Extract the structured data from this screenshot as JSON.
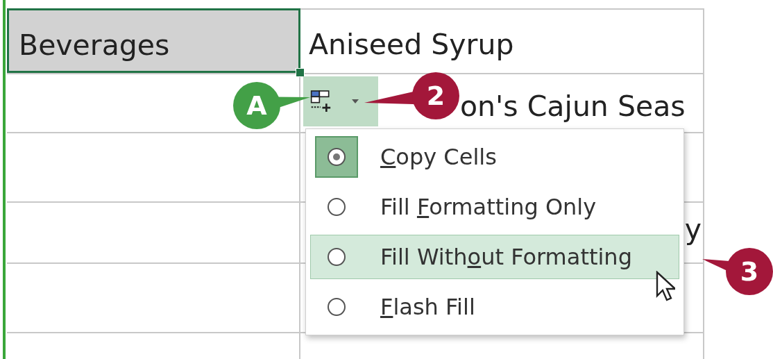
{
  "cells": [
    {
      "column_1": "Beverages",
      "column_2": [
        "Aniseed Syrup"
      ],
      "selected": true
    },
    {
      "column_2": [
        "on's Cajun Seas"
      ],
      "selected": false
    },
    {
      "selected": false
    },
    {
      "column_2": [
        "y"
      ],
      "selected": false
    },
    {
      "selected": false
    }
  ],
  "menu": [
    {
      "key": "C",
      "after": "opy Cells",
      "selected": true,
      "highlighted": false
    },
    {
      "before": "Fill ",
      "key": "F",
      "after": "ormatting Only",
      "selected": false,
      "highlighted": false
    },
    {
      "before": "Fill With",
      "key": "o",
      "after": "ut Formatting",
      "selected": false,
      "highlighted": true
    },
    {
      "key": "F",
      "after": "lash Fill",
      "selected": false,
      "highlighted": false
    }
  ],
  "callouts": [
    {
      "label": "A",
      "color": "#43a047"
    },
    {
      "label": "2",
      "color": "#a3173a"
    },
    {
      "label": "3",
      "color": "#a3173a"
    }
  ]
}
